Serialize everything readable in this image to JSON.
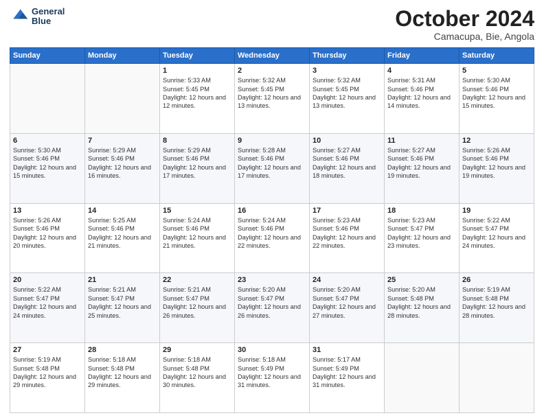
{
  "header": {
    "logo": {
      "general": "General",
      "blue": "Blue"
    },
    "title": "October 2024",
    "location": "Camacupa, Bie, Angola"
  },
  "weekdays": [
    "Sunday",
    "Monday",
    "Tuesday",
    "Wednesday",
    "Thursday",
    "Friday",
    "Saturday"
  ],
  "weeks": [
    [
      null,
      null,
      {
        "day": 1,
        "sunrise": "5:33 AM",
        "sunset": "5:45 PM",
        "daylight": "12 hours and 12 minutes."
      },
      {
        "day": 2,
        "sunrise": "5:32 AM",
        "sunset": "5:45 PM",
        "daylight": "12 hours and 13 minutes."
      },
      {
        "day": 3,
        "sunrise": "5:32 AM",
        "sunset": "5:45 PM",
        "daylight": "12 hours and 13 minutes."
      },
      {
        "day": 4,
        "sunrise": "5:31 AM",
        "sunset": "5:46 PM",
        "daylight": "12 hours and 14 minutes."
      },
      {
        "day": 5,
        "sunrise": "5:30 AM",
        "sunset": "5:46 PM",
        "daylight": "12 hours and 15 minutes."
      }
    ],
    [
      {
        "day": 6,
        "sunrise": "5:30 AM",
        "sunset": "5:46 PM",
        "daylight": "12 hours and 15 minutes."
      },
      {
        "day": 7,
        "sunrise": "5:29 AM",
        "sunset": "5:46 PM",
        "daylight": "12 hours and 16 minutes."
      },
      {
        "day": 8,
        "sunrise": "5:29 AM",
        "sunset": "5:46 PM",
        "daylight": "12 hours and 17 minutes."
      },
      {
        "day": 9,
        "sunrise": "5:28 AM",
        "sunset": "5:46 PM",
        "daylight": "12 hours and 17 minutes."
      },
      {
        "day": 10,
        "sunrise": "5:27 AM",
        "sunset": "5:46 PM",
        "daylight": "12 hours and 18 minutes."
      },
      {
        "day": 11,
        "sunrise": "5:27 AM",
        "sunset": "5:46 PM",
        "daylight": "12 hours and 19 minutes."
      },
      {
        "day": 12,
        "sunrise": "5:26 AM",
        "sunset": "5:46 PM",
        "daylight": "12 hours and 19 minutes."
      }
    ],
    [
      {
        "day": 13,
        "sunrise": "5:26 AM",
        "sunset": "5:46 PM",
        "daylight": "12 hours and 20 minutes."
      },
      {
        "day": 14,
        "sunrise": "5:25 AM",
        "sunset": "5:46 PM",
        "daylight": "12 hours and 21 minutes."
      },
      {
        "day": 15,
        "sunrise": "5:24 AM",
        "sunset": "5:46 PM",
        "daylight": "12 hours and 21 minutes."
      },
      {
        "day": 16,
        "sunrise": "5:24 AM",
        "sunset": "5:46 PM",
        "daylight": "12 hours and 22 minutes."
      },
      {
        "day": 17,
        "sunrise": "5:23 AM",
        "sunset": "5:46 PM",
        "daylight": "12 hours and 22 minutes."
      },
      {
        "day": 18,
        "sunrise": "5:23 AM",
        "sunset": "5:47 PM",
        "daylight": "12 hours and 23 minutes."
      },
      {
        "day": 19,
        "sunrise": "5:22 AM",
        "sunset": "5:47 PM",
        "daylight": "12 hours and 24 minutes."
      }
    ],
    [
      {
        "day": 20,
        "sunrise": "5:22 AM",
        "sunset": "5:47 PM",
        "daylight": "12 hours and 24 minutes."
      },
      {
        "day": 21,
        "sunrise": "5:21 AM",
        "sunset": "5:47 PM",
        "daylight": "12 hours and 25 minutes."
      },
      {
        "day": 22,
        "sunrise": "5:21 AM",
        "sunset": "5:47 PM",
        "daylight": "12 hours and 26 minutes."
      },
      {
        "day": 23,
        "sunrise": "5:20 AM",
        "sunset": "5:47 PM",
        "daylight": "12 hours and 26 minutes."
      },
      {
        "day": 24,
        "sunrise": "5:20 AM",
        "sunset": "5:47 PM",
        "daylight": "12 hours and 27 minutes."
      },
      {
        "day": 25,
        "sunrise": "5:20 AM",
        "sunset": "5:48 PM",
        "daylight": "12 hours and 28 minutes."
      },
      {
        "day": 26,
        "sunrise": "5:19 AM",
        "sunset": "5:48 PM",
        "daylight": "12 hours and 28 minutes."
      }
    ],
    [
      {
        "day": 27,
        "sunrise": "5:19 AM",
        "sunset": "5:48 PM",
        "daylight": "12 hours and 29 minutes."
      },
      {
        "day": 28,
        "sunrise": "5:18 AM",
        "sunset": "5:48 PM",
        "daylight": "12 hours and 29 minutes."
      },
      {
        "day": 29,
        "sunrise": "5:18 AM",
        "sunset": "5:48 PM",
        "daylight": "12 hours and 30 minutes."
      },
      {
        "day": 30,
        "sunrise": "5:18 AM",
        "sunset": "5:49 PM",
        "daylight": "12 hours and 31 minutes."
      },
      {
        "day": 31,
        "sunrise": "5:17 AM",
        "sunset": "5:49 PM",
        "daylight": "12 hours and 31 minutes."
      },
      null,
      null
    ]
  ]
}
